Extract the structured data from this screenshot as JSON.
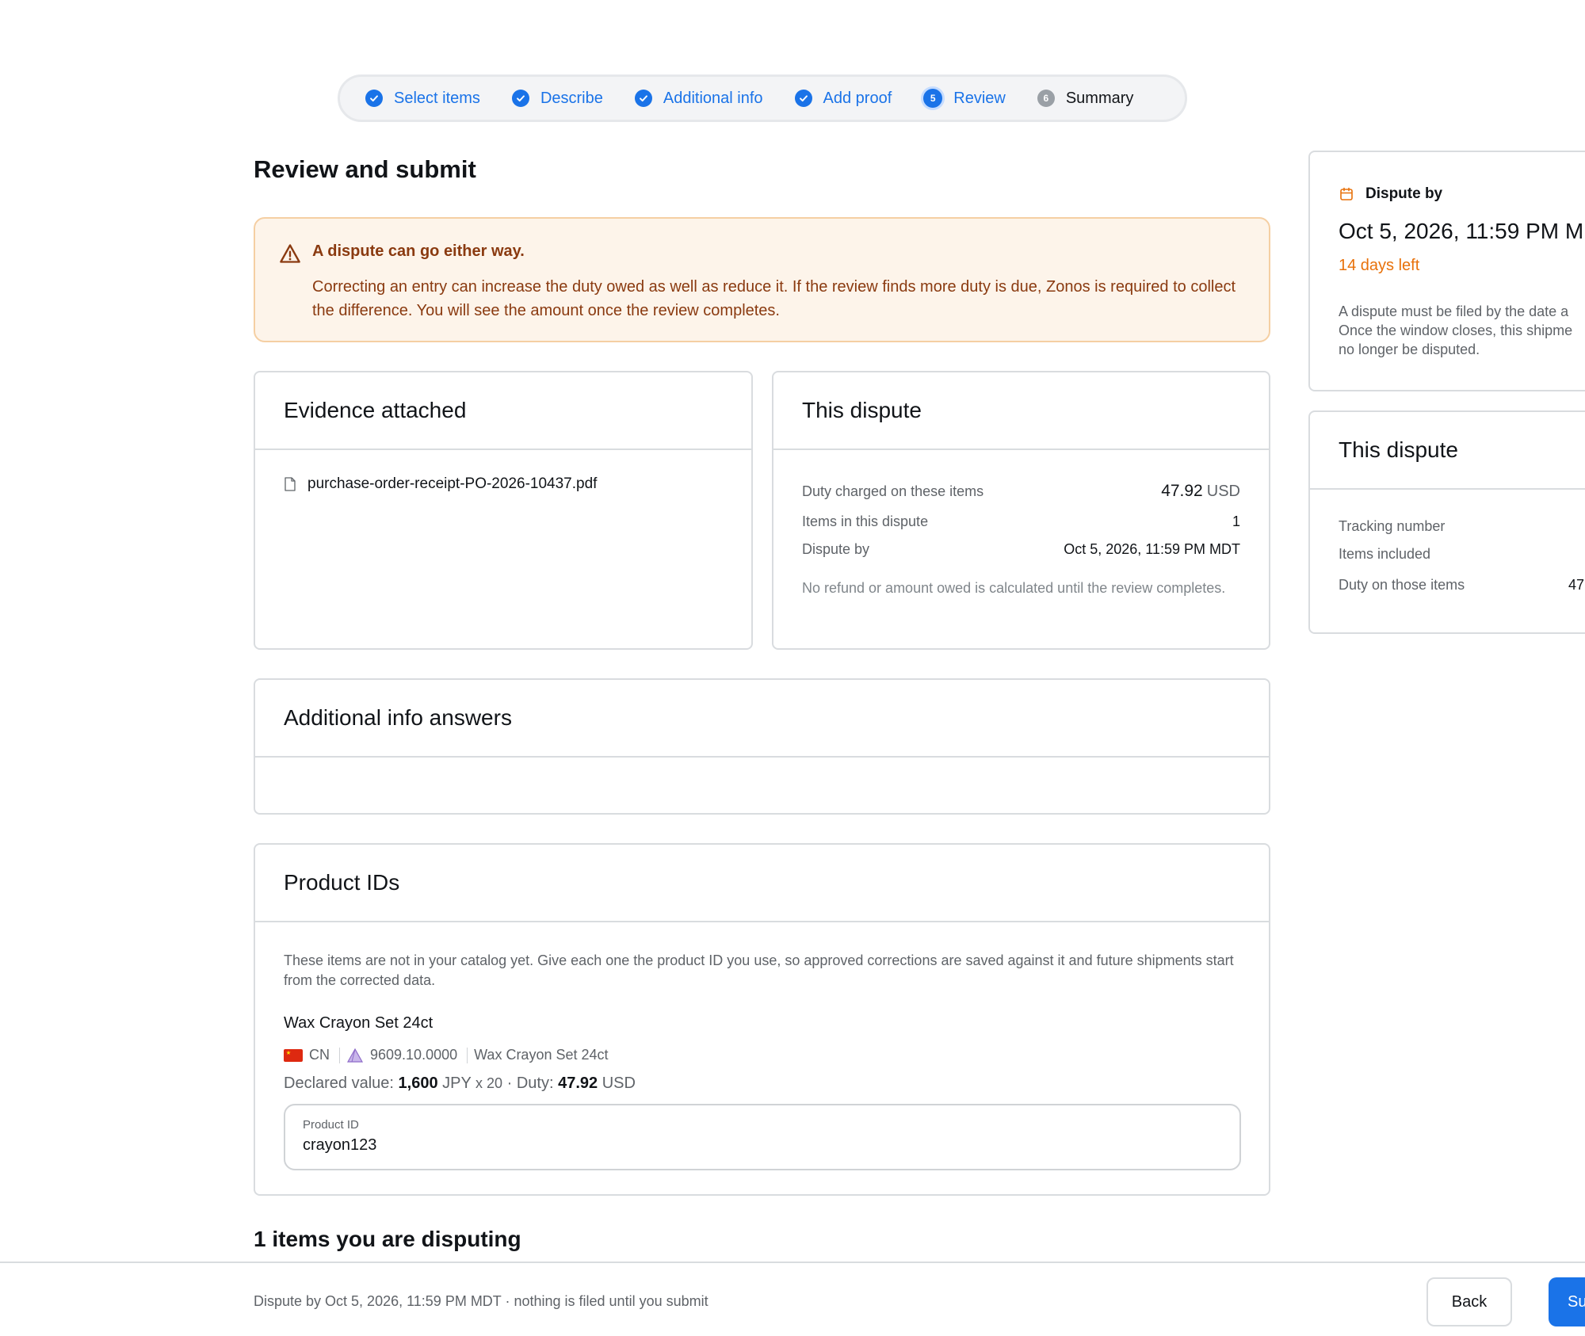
{
  "stepper": {
    "steps": [
      {
        "label": "Select items",
        "state": "done"
      },
      {
        "label": "Describe",
        "state": "done"
      },
      {
        "label": "Additional info",
        "state": "done"
      },
      {
        "label": "Add proof",
        "state": "done"
      },
      {
        "label": "Review",
        "state": "current",
        "number": "5"
      },
      {
        "label": "Summary",
        "state": "pending",
        "number": "6"
      }
    ]
  },
  "page_title": "Review and submit",
  "warning": {
    "title": "A dispute can go either way.",
    "body": "Correcting an entry can increase the duty owed as well as reduce it. If the review finds more duty is due, Zonos is required to collect the difference. You will see the amount once the review completes."
  },
  "evidence": {
    "title": "Evidence attached",
    "file": "purchase-order-receipt-PO-2026-10437.pdf"
  },
  "dispute_card": {
    "title": "This dispute",
    "duty_label": "Duty charged on these items",
    "duty_value": "47.92",
    "duty_unit": "USD",
    "items_label": "Items in this dispute",
    "items_value": "1",
    "by_label": "Dispute by",
    "by_value": "Oct 5, 2026, 11:59 PM MDT",
    "note": "No refund or amount owed is calculated until the review completes."
  },
  "additional_info": {
    "title": "Additional info answers"
  },
  "product_ids": {
    "title": "Product IDs",
    "description": "These items are not in your catalog yet. Give each one the product ID you use, so approved corrections are saved against it and future shipments start from the corrected data.",
    "item_name": "Wax Crayon Set 24ct",
    "country": "CN",
    "hs_code": "9609.10.0000",
    "item_desc": "Wax Crayon Set 24ct",
    "declared_label": "Declared value:",
    "declared_value": "1,600",
    "declared_currency": "JPY",
    "quantity": "x 20",
    "duty_label": "· Duty:",
    "duty_value": "47.92",
    "duty_currency": "USD",
    "field_label": "Product ID",
    "field_value": "crayon123"
  },
  "items_heading": "1 items you are disputing",
  "footer": {
    "text": "Dispute by Oct 5, 2026, 11:59 PM MDT · nothing is filed until you submit",
    "back_label": "Back",
    "submit_label": "Subm"
  },
  "side_deadline": {
    "label": "Dispute by",
    "date": "Oct 5, 2026, 11:59 PM M",
    "days_left": "14 days left",
    "line1": "A dispute must be filed by the date a",
    "line2": "Once the window closes, this shipme",
    "line3": "no longer be disputed."
  },
  "side_dispute": {
    "title": "This dispute",
    "tracking_label": "Tracking number",
    "items_label": "Items included",
    "duty_label": "Duty on those items",
    "duty_value": "47"
  },
  "colors": {
    "accent": "#1a73e8",
    "warning_bg": "#fdf4ea",
    "warning_text": "#8a3a10",
    "days_left": "#e8710a"
  }
}
